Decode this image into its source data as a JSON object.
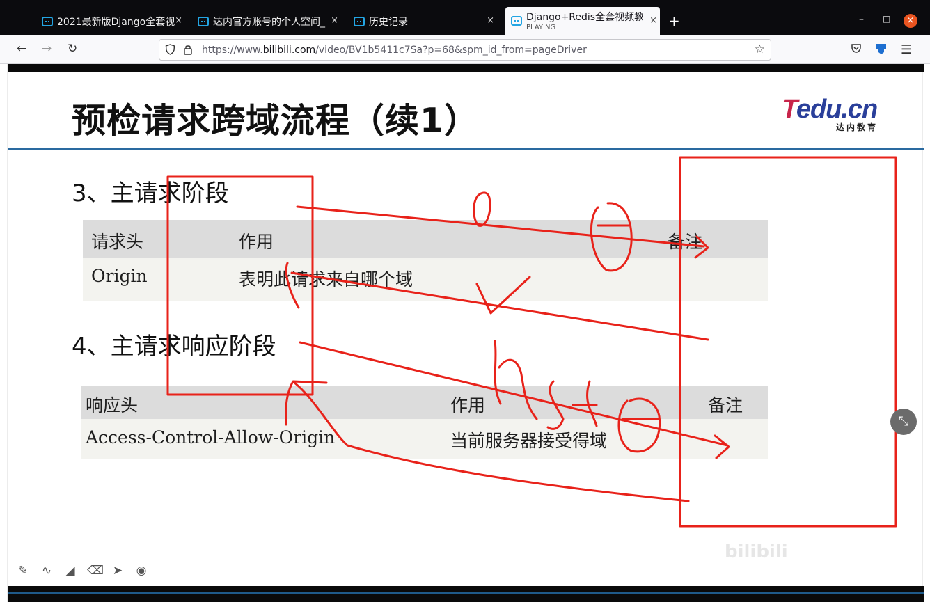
{
  "browser": {
    "tabs": [
      {
        "title": "2021最新版Django全套视",
        "close": "×"
      },
      {
        "title": "达内官方账号的个人空间_",
        "close": "×"
      },
      {
        "title": "历史记录",
        "close": "×"
      },
      {
        "title": "Django+Redis全套视频教",
        "subtitle": "PLAYING",
        "close": "×",
        "active": true
      }
    ],
    "new_tab": "+",
    "window_controls": {
      "minimize": "–",
      "maximize": "□",
      "close": "×"
    },
    "nav": {
      "back": "←",
      "forward": "→",
      "reload": "↻"
    },
    "url": {
      "prefix": "https://www.",
      "host": "bilibili.com",
      "path": "/video/BV1b5411c7Sa?p=68&spm_id_from=pageDriver"
    },
    "icons": {
      "shield": "shield-icon",
      "lock": "lock-icon",
      "star": "star-icon",
      "pocket": "pocket-icon",
      "extension": "extension-icon",
      "menu": "hamburger-menu-icon"
    }
  },
  "slide": {
    "title": "预检请求跨域流程（续1）",
    "logo": {
      "brand_t": "T",
      "brand_rest": "edu.cn",
      "sub": "达内教育"
    },
    "section3": "3、主请求阶段",
    "table1": {
      "headers": [
        "请求头",
        "作用",
        "备注"
      ],
      "row": [
        "Origin",
        "表明此请求来自哪个域",
        ""
      ]
    },
    "section4": "4、主请求响应阶段",
    "table2": {
      "headers": [
        "响应头",
        "作用",
        "备注"
      ],
      "row": [
        "Access-Control-Allow-Origin",
        "当前服务器接受得域",
        ""
      ]
    }
  },
  "player": {
    "pen_tools": [
      "pencil-icon",
      "curve-icon",
      "highlighter-icon",
      "eraser-icon",
      "pointer-icon",
      "record-icon"
    ],
    "exit_fullscreen": "⤡",
    "watermark": "bilibili"
  },
  "colors": {
    "annotation": "#e8221a",
    "tab_icon": "#23a5e3",
    "title_rule": "#2a6aa0",
    "logo_red": "#c8244a",
    "logo_blue": "#2a3f9a"
  }
}
